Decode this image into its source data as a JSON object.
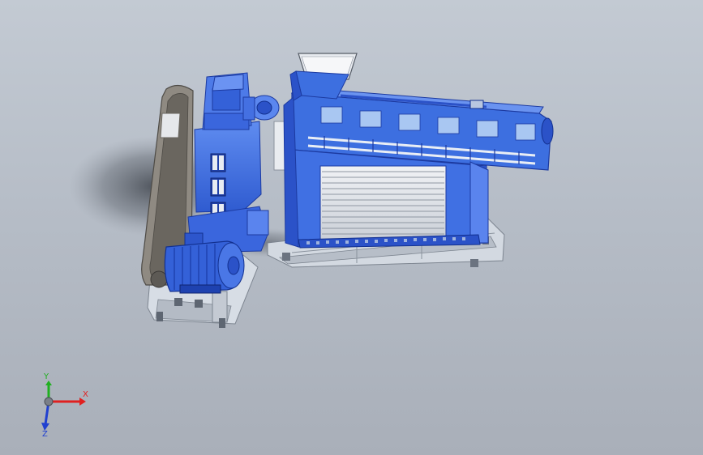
{
  "viewport": {
    "background": "#b9c0ca",
    "model": {
      "name": "extruder-assembly",
      "colors": {
        "body": "#3d6fe0",
        "body_dark": "#2448b0",
        "body_light": "#6c95f0",
        "window": "#a9c7f2",
        "frame": "#d7dde5",
        "frame_dark": "#8e96a1",
        "belt": "#8f8a82",
        "belt_dark": "#5d5a55",
        "hopper": "#e7eaef",
        "shadow": "#5f6570"
      }
    }
  },
  "triad": {
    "x_label": "X",
    "y_label": "Y",
    "z_label": "Z",
    "x_color": "#e02020",
    "y_color": "#20b020",
    "z_color": "#2040d0"
  }
}
